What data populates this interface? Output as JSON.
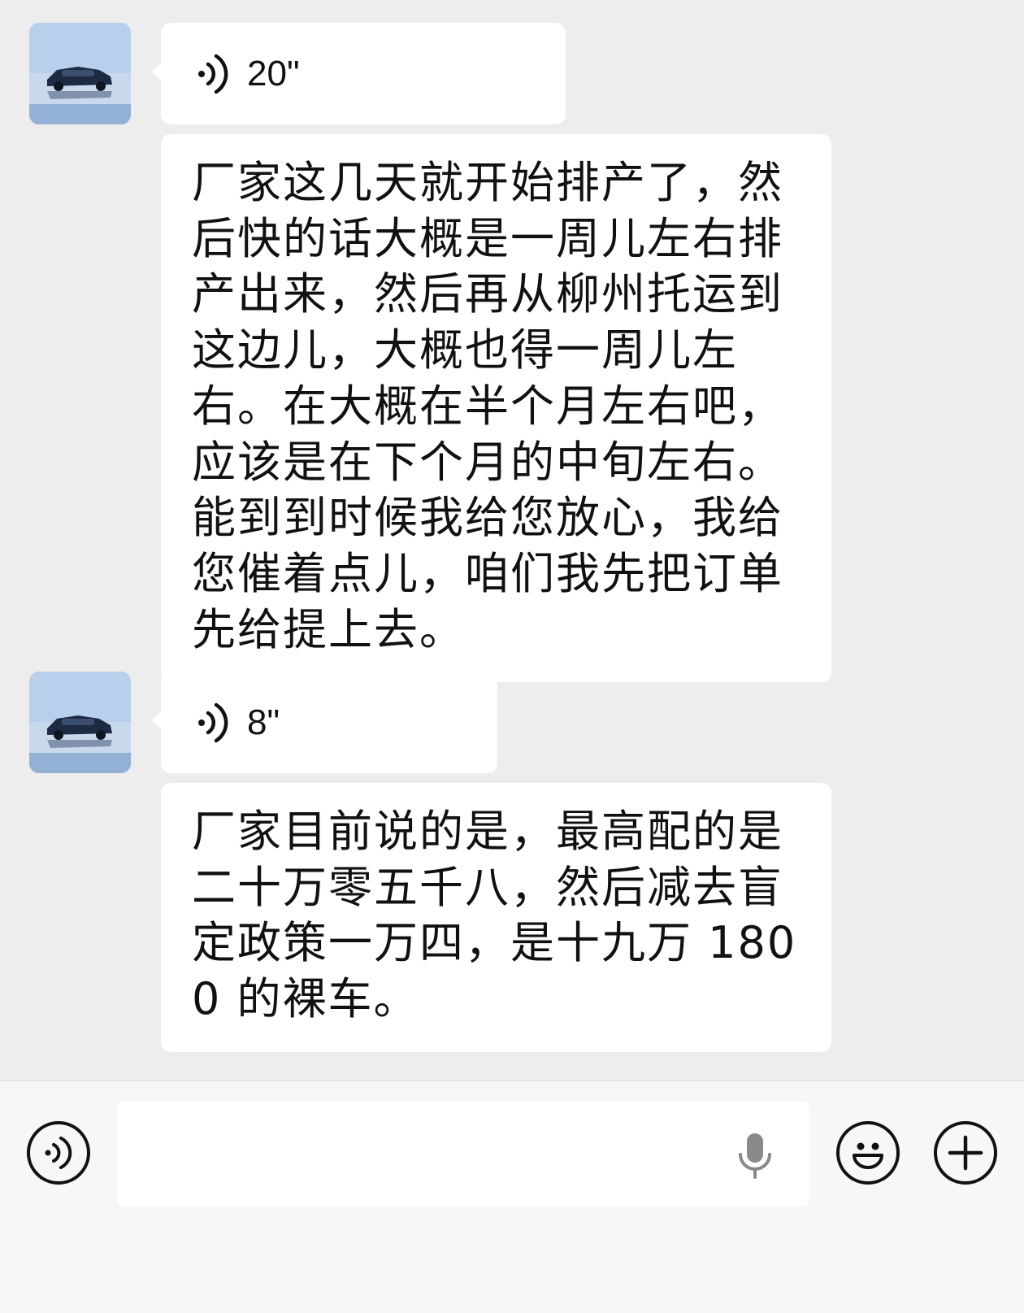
{
  "messages": [
    {
      "type": "voice",
      "duration": "20\"",
      "icon": "voice-wave-icon",
      "transcript": "厂家这几天就开始排产了，然后快的话大概是一周儿左右排产出来，然后再从柳州托运到这边儿，大概也得一周儿左右。在大概在半个月左右吧，应该是在下个月的中旬左右。能到到时候我给您放心，我给您催着点儿，咱们我先把订单先给提上去。"
    },
    {
      "type": "voice",
      "duration": "8\"",
      "icon": "voice-wave-icon",
      "transcript": "厂家目前说的是，最高配的是二十万零五千八，然后减去盲定政策一万四，是十九万 1800 的裸车。"
    }
  ],
  "input_bar": {
    "voice_toggle_icon": "voice-mode-icon",
    "text_value": "",
    "mic_icon": "microphone-icon",
    "emoji_icon": "emoji-icon",
    "more_icon": "plus-icon"
  },
  "colors": {
    "background": "#ededed",
    "bubble": "#ffffff",
    "input_bar": "#f7f7f7"
  }
}
